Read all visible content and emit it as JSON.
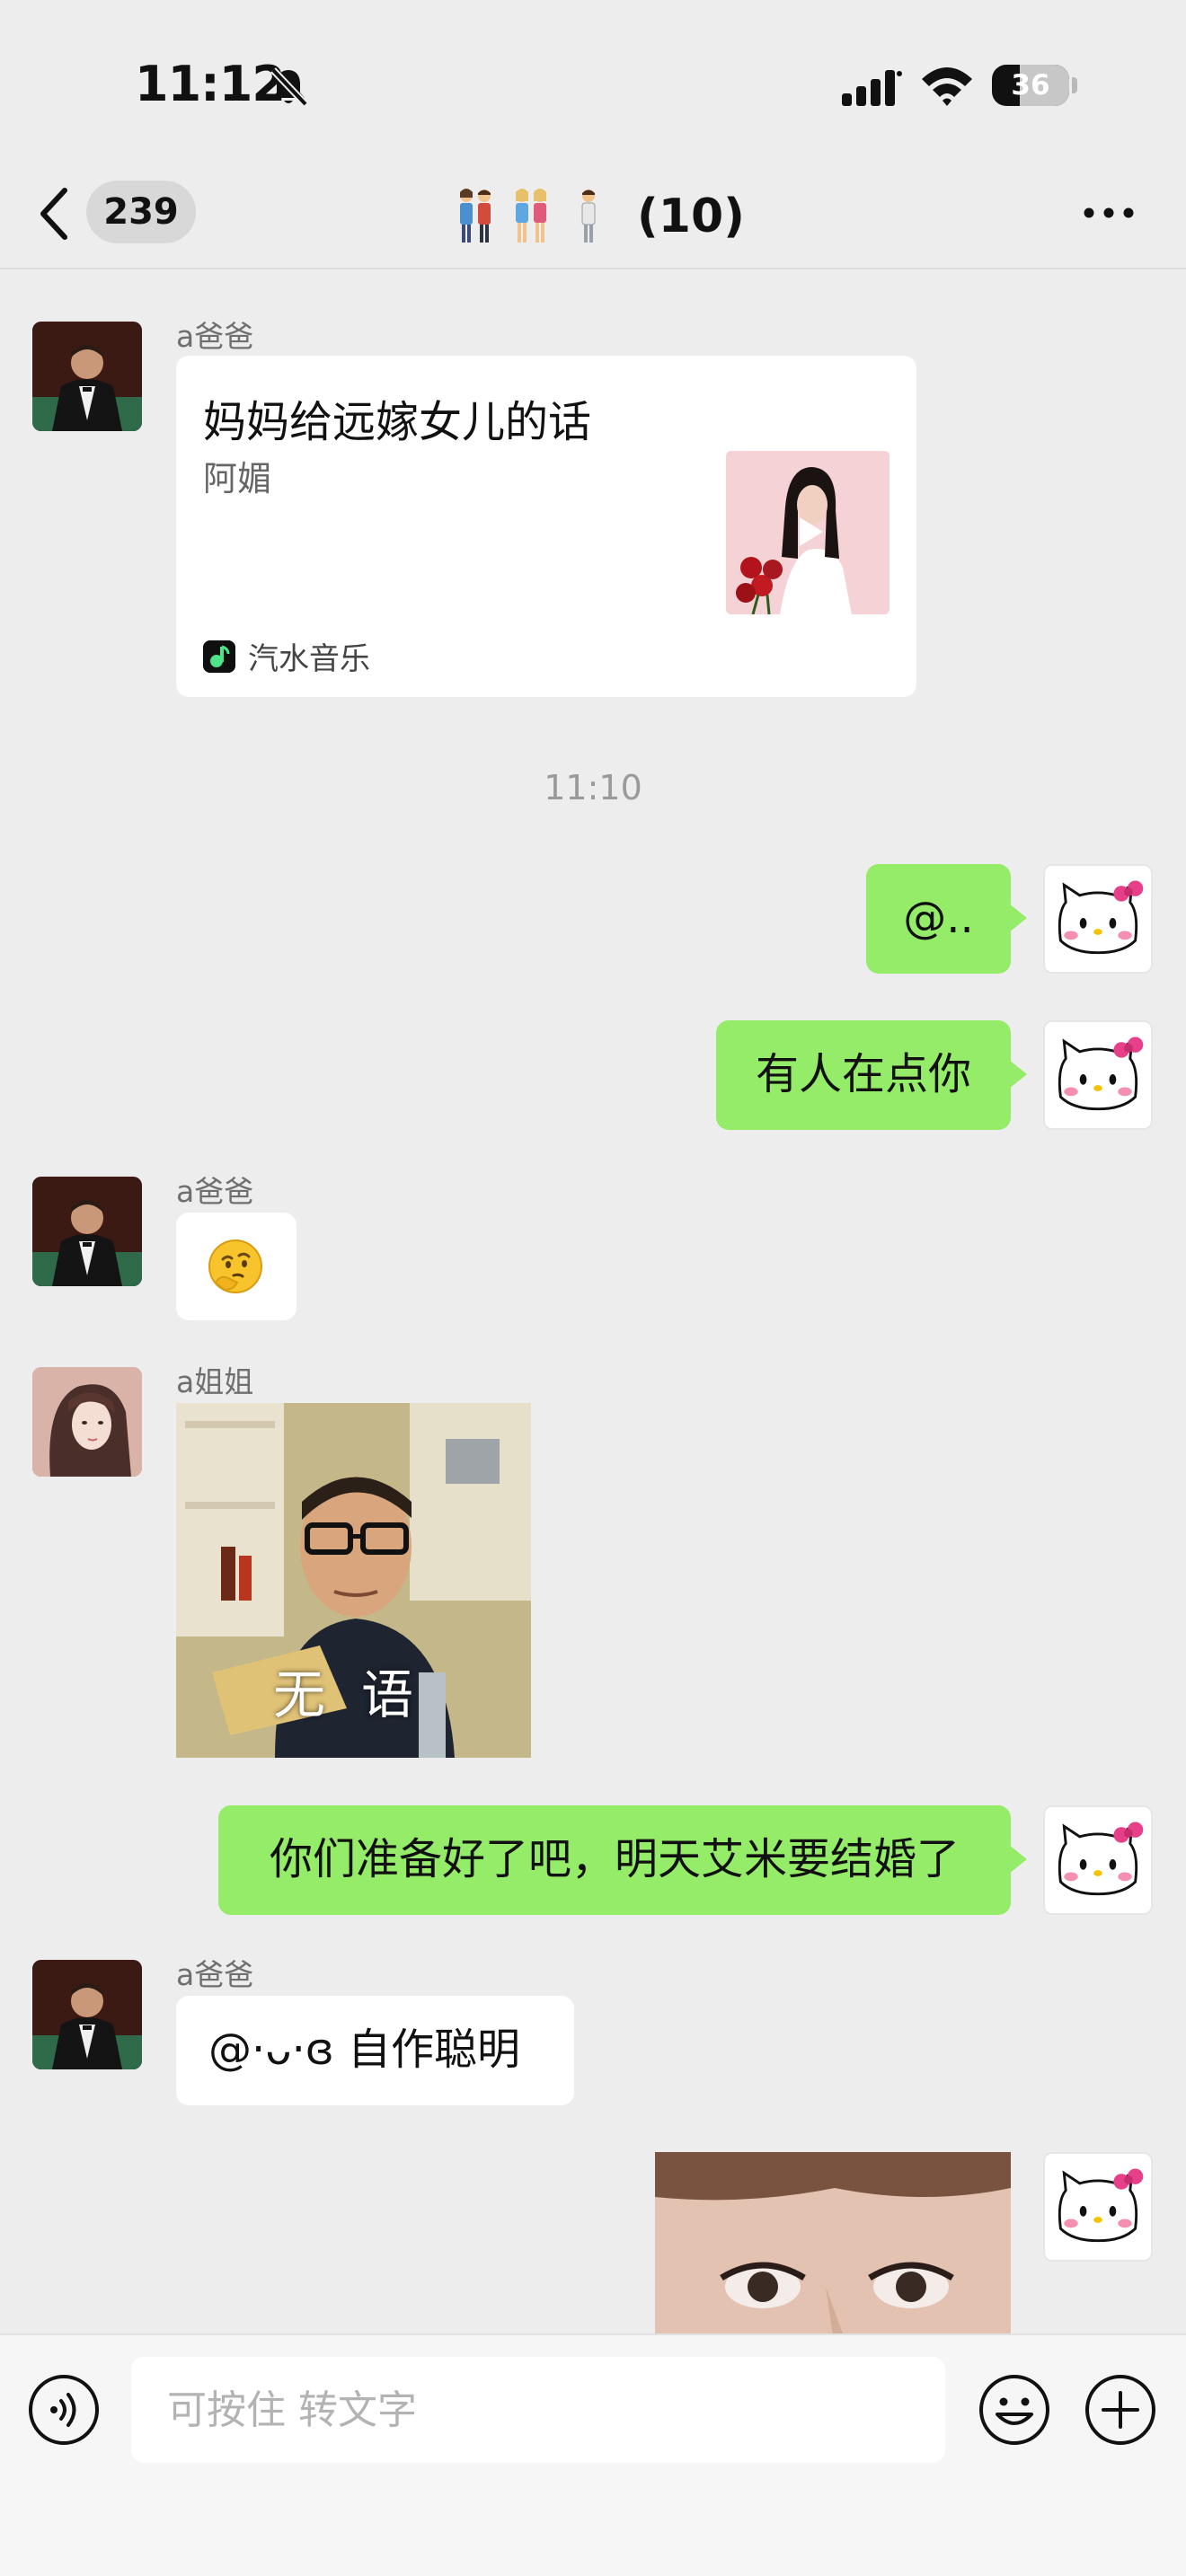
{
  "status_bar": {
    "time": "11:12",
    "battery": "36",
    "battery_level": 0.36
  },
  "nav": {
    "unread_count": "239",
    "title_count": "(10)"
  },
  "messages": {
    "m1": {
      "sender": "a爸爸",
      "card_title": "妈妈给远嫁女儿的话",
      "card_artist": "阿媚",
      "card_source": "汽水音乐"
    },
    "timestamp": "11:10",
    "m2": {
      "text": "@.."
    },
    "m3": {
      "text": "有人在点你"
    },
    "m4": {
      "sender": "a爸爸",
      "emoji": "thinking-face"
    },
    "m5": {
      "sender": "a姐姐",
      "sticker_caption": "无语"
    },
    "m6": {
      "text": "你们准备好了吧，明天艾米要结婚了"
    },
    "m7": {
      "sender": "a爸爸",
      "text": "@·ᴗ·ɞ 自作聪明"
    }
  },
  "input": {
    "placeholder": "可按住 转文字"
  },
  "colors": {
    "background": "#ededed",
    "outgoing_bubble": "#95ec69",
    "incoming_bubble": "#ffffff"
  }
}
